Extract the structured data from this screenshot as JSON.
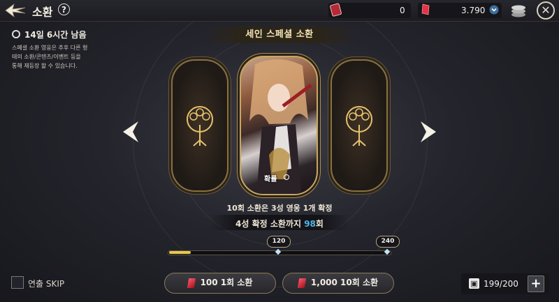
{
  "header": {
    "title": "소환",
    "help_symbol": "?",
    "close_symbol": "✕",
    "currencies": [
      {
        "icon": "summon-ticket-icon",
        "value": "0"
      },
      {
        "icon": "red-gem-icon",
        "value": "3.790"
      }
    ]
  },
  "event": {
    "timer_text": "14일 6시간 남음",
    "description": "스페셜 소환 영웅은 추후 다른 형\n태의 소환/콘텐츠/이벤트 등을\n통해 재등장 할 수 있습니다."
  },
  "banner": {
    "title": "세인 스페셜 소환",
    "probability_label": "확률"
  },
  "info": {
    "guarantee_text": "10회 소환은 3성 영웅 1개 확정",
    "pity_prefix": "4성 확정 소환까지 ",
    "pity_count": "98",
    "pity_suffix": "회"
  },
  "progress": {
    "current": 6,
    "max": 240,
    "milestones": [
      "120",
      "240"
    ]
  },
  "bottom": {
    "skip_label": "연출 SKIP",
    "summon_1_label": "100 1회 소환",
    "summon_10_label": "1,000 10회 소환",
    "inventory": "199/200",
    "plus_symbol": "+"
  },
  "colors": {
    "accent_gold": "#c9a760",
    "highlight_blue": "#4fb6e8",
    "gem_red": "#d9283a"
  }
}
